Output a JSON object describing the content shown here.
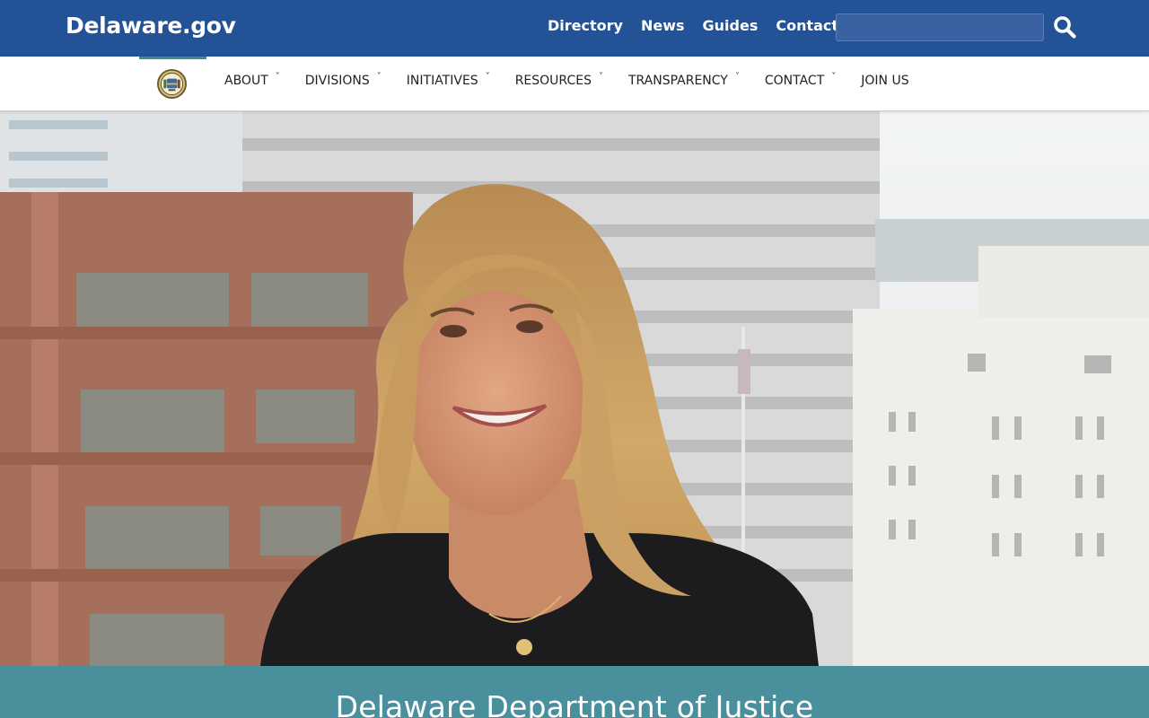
{
  "header": {
    "brand": "Delaware.gov",
    "links": [
      {
        "label": "Directory"
      },
      {
        "label": "News"
      },
      {
        "label": "Guides"
      },
      {
        "label": "Contact"
      }
    ],
    "search": {
      "value": "",
      "placeholder": ""
    },
    "search_icon": "search-icon"
  },
  "nav": {
    "seal_icon": "delaware-seal-icon",
    "items": [
      {
        "label": "ABOUT",
        "dropdown": true
      },
      {
        "label": "DIVISIONS",
        "dropdown": true
      },
      {
        "label": "INITIATIVES",
        "dropdown": true
      },
      {
        "label": "RESOURCES",
        "dropdown": true
      },
      {
        "label": "TRANSPARENCY",
        "dropdown": true
      },
      {
        "label": "CONTACT",
        "dropdown": true
      },
      {
        "label": "JOIN US",
        "dropdown": false
      }
    ],
    "caret_glyph": "˅"
  },
  "hero": {
    "image": "photo of smiling woman in front of city buildings"
  },
  "banner": {
    "title": "Delaware Department of Justice"
  },
  "colors": {
    "topbar": "#245296",
    "accent_teal": "#4a8f9c",
    "nav_text": "#222222"
  }
}
